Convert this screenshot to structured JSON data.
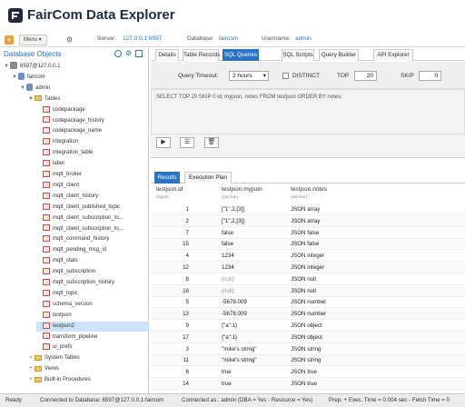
{
  "header": {
    "title": "FairCom Data Explorer"
  },
  "toolbar": {
    "menu_label": "Menu",
    "server_label": "Server:",
    "server_value": "127.0.0.1:6597",
    "database_label": "Database:",
    "database_value": "faircom",
    "username_label": "Username:",
    "username_value": "admin"
  },
  "left": {
    "title": "Database Objects",
    "tree": [
      {
        "label": "6597@127.0.0.1",
        "kind": "server",
        "indent": 0,
        "toggle": "▼"
      },
      {
        "label": "faircom",
        "kind": "db",
        "indent": 1,
        "toggle": "▼"
      },
      {
        "label": "admin",
        "kind": "user",
        "indent": 2,
        "toggle": "▼"
      },
      {
        "label": "Tables",
        "kind": "folder",
        "indent": 3,
        "toggle": "▼"
      },
      {
        "label": "codepackage",
        "kind": "table",
        "indent": 4
      },
      {
        "label": "codepackage_history",
        "kind": "table",
        "indent": 4
      },
      {
        "label": "codepackage_name",
        "kind": "table",
        "indent": 4
      },
      {
        "label": "integration",
        "kind": "table",
        "indent": 4
      },
      {
        "label": "integration_table",
        "kind": "table",
        "indent": 4
      },
      {
        "label": "label",
        "kind": "table",
        "indent": 4
      },
      {
        "label": "mqtt_broker",
        "kind": "table",
        "indent": 4
      },
      {
        "label": "mqtt_client",
        "kind": "table",
        "indent": 4
      },
      {
        "label": "mqtt_client_history",
        "kind": "table",
        "indent": 4
      },
      {
        "label": "mqtt_client_published_topic",
        "kind": "table",
        "indent": 4
      },
      {
        "label": "mqtt_client_subscription_to...",
        "kind": "table",
        "indent": 4
      },
      {
        "label": "mqtt_client_subscription_to...",
        "kind": "table",
        "indent": 4
      },
      {
        "label": "mqtt_command_history",
        "kind": "table",
        "indent": 4
      },
      {
        "label": "mqtt_pending_msg_id",
        "kind": "table",
        "indent": 4
      },
      {
        "label": "mqtt_stats",
        "kind": "table",
        "indent": 4
      },
      {
        "label": "mqtt_subscription",
        "kind": "table",
        "indent": 4
      },
      {
        "label": "mqtt_subscription_history",
        "kind": "table",
        "indent": 4
      },
      {
        "label": "mqtt_topic",
        "kind": "table",
        "indent": 4
      },
      {
        "label": "schema_version",
        "kind": "table",
        "indent": 4
      },
      {
        "label": "testjson",
        "kind": "table",
        "indent": 4
      },
      {
        "label": "testjson2",
        "kind": "table",
        "indent": 4,
        "selected": true
      },
      {
        "label": "transform_pipeline",
        "kind": "table",
        "indent": 4
      },
      {
        "label": "ui_prefs",
        "kind": "table",
        "indent": 4
      },
      {
        "label": "System Tables",
        "kind": "folder",
        "indent": 3,
        "toggle": "+"
      },
      {
        "label": "Views",
        "kind": "folder",
        "indent": 3,
        "toggle": "+"
      },
      {
        "label": "Built-in Procedures",
        "kind": "folder",
        "indent": 3,
        "toggle": "+"
      }
    ]
  },
  "tabs": [
    "Details",
    "Table Records",
    "SQL Queries",
    "SQL Scripts",
    "Query Builder",
    "API Explorer"
  ],
  "active_tab": "SQL Queries",
  "query_options": {
    "timeout_label": "Query Timeout:",
    "timeout_value": "2 hours",
    "distinct_label": "DISTINCT",
    "top_label": "TOP",
    "top_value": "20",
    "skip_label": "SKIP",
    "skip_value": "0"
  },
  "sql": "SELECT TOP 20 SKIP 0 id, myjson, notes FROM testjson ORDER BY notes;",
  "buttons": {
    "run": "▶",
    "list": "☰",
    "delete": "🗑"
  },
  "result_tabs": [
    "Results",
    "Execution Plan"
  ],
  "columns": [
    {
      "name": "testjson.id",
      "type": "(bigint)"
    },
    {
      "name": "testjson.myjson",
      "type": "(varchar)"
    },
    {
      "name": "testjson.notes",
      "type": "(varchar)"
    }
  ],
  "rows": [
    [
      "1",
      "[\"1\",2,[3]]",
      "JSON array"
    ],
    [
      "2",
      "[\"1\",2,[3]]",
      "JSON array"
    ],
    [
      "7",
      "false",
      "JSON false"
    ],
    [
      "15",
      "false",
      "JSON false"
    ],
    [
      "4",
      "1234",
      "JSON integer"
    ],
    [
      "12",
      "1234",
      "JSON integer"
    ],
    [
      "8",
      "(null)",
      "JSON null"
    ],
    [
      "16",
      "(null)",
      "JSON null"
    ],
    [
      "5",
      "-5678.009",
      "JSON number"
    ],
    [
      "13",
      "-5678.009",
      "JSON number"
    ],
    [
      "9",
      "{\"a\":1}",
      "JSON object"
    ],
    [
      "17",
      "{\"a\":1}",
      "JSON object"
    ],
    [
      "3",
      "\"mike's string\"",
      "JSON string"
    ],
    [
      "11",
      "\"mike's string\"",
      "JSON string"
    ],
    [
      "6",
      "true",
      "JSON true"
    ],
    [
      "14",
      "true",
      "JSON true"
    ]
  ],
  "status": {
    "ready": "Ready",
    "connected": "Connected to Database: 6597@127.0.0.1:faircom",
    "as": "Connected as : admin (DBA = Yes - Resource = Yes)",
    "timing": "Prep. + Exec. Time = 0.004 sec - Fetch Time = 0"
  }
}
